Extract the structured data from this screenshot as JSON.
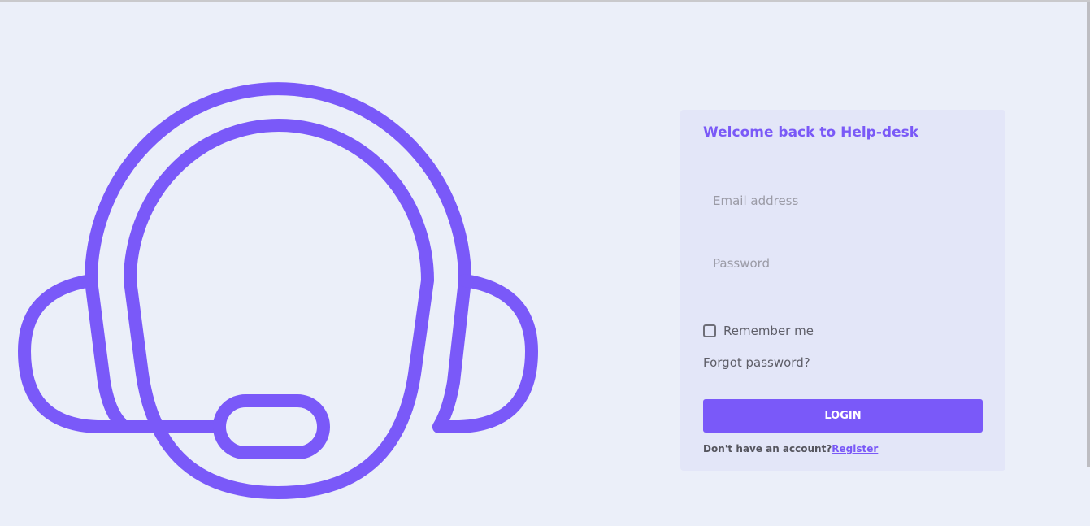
{
  "colors": {
    "background": "#ebeff9",
    "card_background": "#e3e6f8",
    "accent": "#7a59f9",
    "text_muted": "#5e5e68"
  },
  "illustration": {
    "icon": "headset-icon"
  },
  "login": {
    "title": "Welcome back to Help-desk",
    "email_placeholder": "Email address",
    "email_value": "",
    "password_placeholder": "Password",
    "password_value": "",
    "remember_label": "Remember me",
    "remember_checked": false,
    "forgot_password": "Forgot password?",
    "login_button": "LOGIN",
    "no_account_text": "Don't have an account?",
    "register_link": "Register"
  }
}
